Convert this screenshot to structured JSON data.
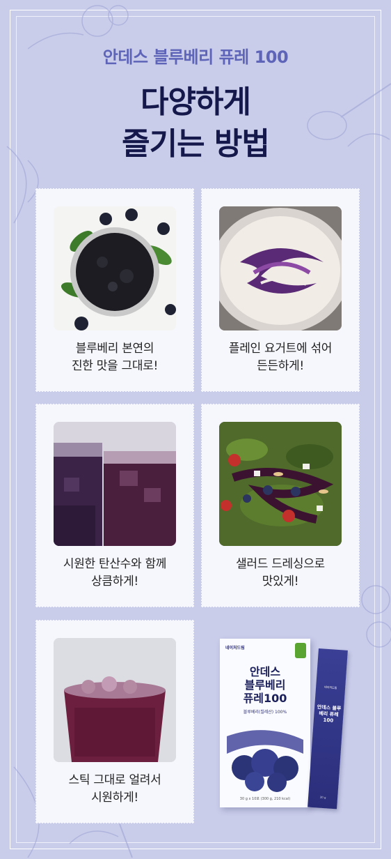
{
  "header": {
    "subtitle": "안데스 블루베리 퓨레 100",
    "title_line1": "다양하게",
    "title_line2": "즐기는 방법"
  },
  "cards": [
    {
      "line1": "블루베리 본연의",
      "line2": "진한 맛을 그대로!",
      "image": "blueberry-jam-bowl"
    },
    {
      "line1": "플레인 요거트에 섞어",
      "line2": "든든하게!",
      "image": "yogurt-blueberry-swirl"
    },
    {
      "line1": "시원한 탄산수와 함께",
      "line2": "상큼하게!",
      "image": "blueberry-soda-glasses"
    },
    {
      "line1": "샐러드 드레싱으로",
      "line2": "맛있게!",
      "image": "salad-blueberry-dressing"
    },
    {
      "line1": "스틱 그대로 얼려서",
      "line2": "시원하게!",
      "image": "frozen-blueberry-slush"
    }
  ],
  "product": {
    "box_brand": "네이처드림",
    "box_name_line1": "안데스",
    "box_name_line2": "블루베리",
    "box_name_line3": "퓨레100",
    "box_sub": "블루베리(칠레산) 100%",
    "box_net": "30 g x 10포 (300 g, 210 kcal)",
    "stick_brand": "네이처드림",
    "stick_name": "안데스 블루베리 퓨레100",
    "stick_net": "30 g"
  },
  "colors": {
    "background": "#c9cdea",
    "subtitle": "#5e64b8",
    "title": "#14184a",
    "card": "#f6f7fd"
  }
}
